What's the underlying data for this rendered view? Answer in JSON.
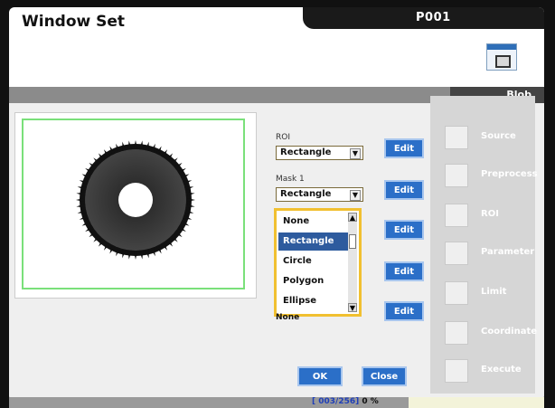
{
  "window": {
    "title": "Window Set",
    "program_id": "P001",
    "active_tab": "Blob"
  },
  "sidebar": {
    "items": [
      {
        "label": "Source",
        "icon": "source-icon"
      },
      {
        "label": "Preprocess",
        "icon": "preprocess-icon"
      },
      {
        "label": "ROI",
        "icon": "roi-icon"
      },
      {
        "label": "Parameter",
        "icon": "parameter-icon"
      },
      {
        "label": "Limit",
        "icon": "limit-icon"
      },
      {
        "label": "Coordinate",
        "icon": "coordinate-icon"
      },
      {
        "label": "Execute",
        "icon": "execute-icon"
      }
    ]
  },
  "roi": {
    "label": "ROI",
    "value": "Rectangle",
    "edit_label": "Edit"
  },
  "mask1": {
    "label": "Mask 1",
    "value": "Rectangle",
    "edit_label": "Edit"
  },
  "dropdown": {
    "options": [
      "None",
      "Rectangle",
      "Circle",
      "Polygon",
      "Ellipse"
    ],
    "selected": "Rectangle"
  },
  "hidden_combo": {
    "value": "None"
  },
  "edit_buttons": [
    "Edit",
    "Edit",
    "Edit"
  ],
  "buttons": {
    "ok": "OK",
    "close": "Close"
  },
  "status": {
    "counter": "[ 003/256]",
    "percent": "0 %"
  },
  "colors": {
    "accent": "#2b6fc8",
    "selection": "#2e5b9e",
    "dropdown_border": "#f1c030",
    "roi_outline": "#7ae07a"
  }
}
